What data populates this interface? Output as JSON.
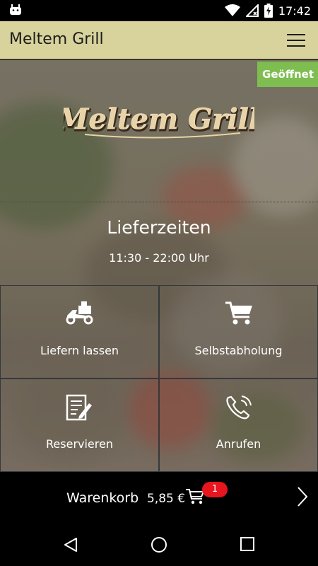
{
  "status_bar": {
    "time": "17:42"
  },
  "app_bar": {
    "title": "Meltem Grill"
  },
  "hero": {
    "status_badge": "Geöffnet",
    "logo_text": "Meltem Grill",
    "hours_title": "Lieferzeiten",
    "hours_time": "11:30 - 22:00 Uhr"
  },
  "actions": [
    {
      "label": "Liefern lassen",
      "icon": "delivery-scooter-icon"
    },
    {
      "label": "Selbstabholung",
      "icon": "shopping-cart-icon"
    },
    {
      "label": "Reservieren",
      "icon": "reservation-document-icon"
    },
    {
      "label": "Anrufen",
      "icon": "phone-call-icon"
    }
  ],
  "cart": {
    "label": "Warenkorb",
    "price": "5,85 €",
    "count": "1"
  },
  "colors": {
    "app_bar": "#d8d39c",
    "badge": "#7ebd4f",
    "cart_badge": "#e8141e"
  }
}
